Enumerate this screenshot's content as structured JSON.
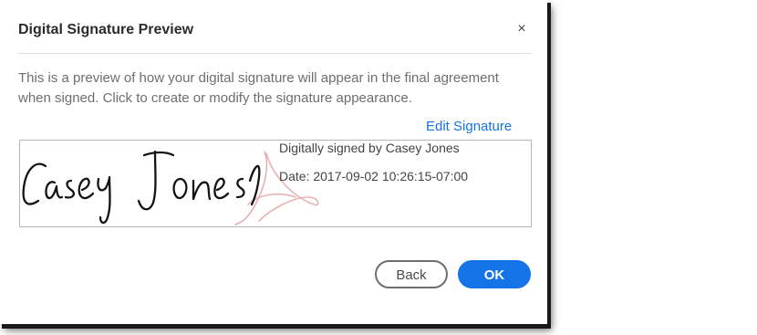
{
  "dialog": {
    "title": "Digital Signature Preview",
    "close_label": "×",
    "description": "This is a preview of how your digital signature will appear in the final agreement when signed. Click to create or modify the signature appearance.",
    "edit_link": "Edit Signature"
  },
  "signature": {
    "handwritten_name": "Casey Jones",
    "signed_by_line": "Digitally signed by Casey Jones",
    "date_line": "Date: 2017-09-02 10:26:15-07:00"
  },
  "buttons": {
    "back_label": "Back",
    "ok_label": "OK"
  },
  "colors": {
    "accent": "#1473e6",
    "watermark": "#e9b1b1"
  },
  "icons": {
    "close": "close-icon",
    "watermark": "adobe-sign-watermark-icon"
  }
}
